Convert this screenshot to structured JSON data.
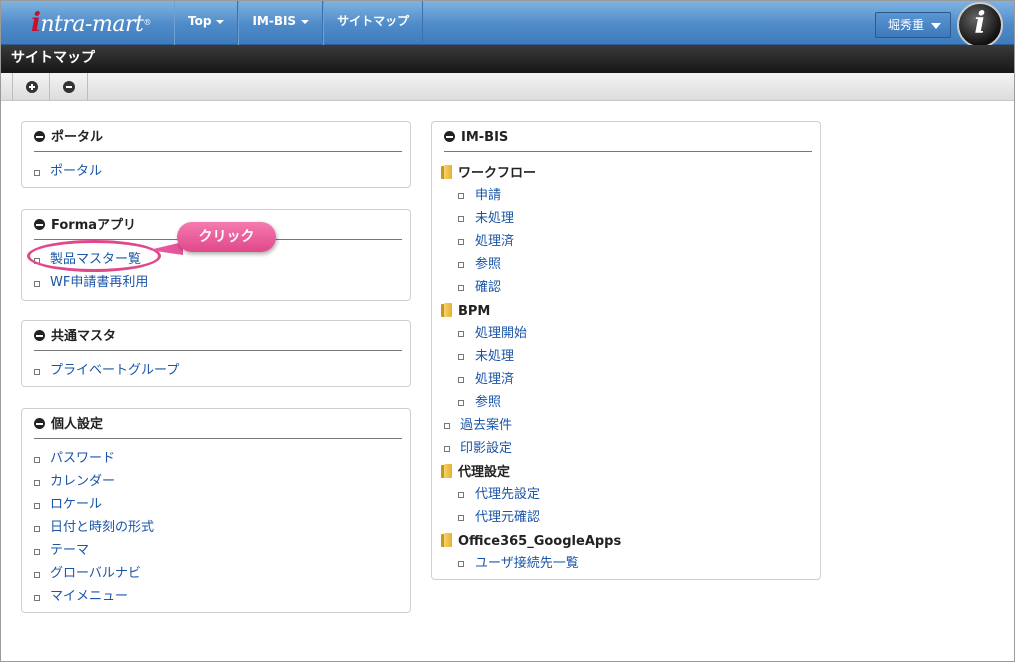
{
  "header": {
    "logo_text": "intra-mart",
    "nav": [
      {
        "label": "Top",
        "dropdown": true
      },
      {
        "label": "IM-BIS",
        "dropdown": true
      },
      {
        "label": "サイトマップ",
        "dropdown": false
      }
    ],
    "user_label": "堀秀重",
    "info_glyph": "i"
  },
  "page_title": "サイトマップ",
  "toolbar": {
    "expand_icon": "plus-circle-icon",
    "collapse_icon": "minus-circle-icon"
  },
  "panels": {
    "portal": {
      "title": "ポータル",
      "links": [
        "ポータル"
      ]
    },
    "forma": {
      "title": "Formaアプリ",
      "links": [
        "製品マスター覧",
        "WF申請書再利用"
      ]
    },
    "common_master": {
      "title": "共通マスタ",
      "links": [
        "プライベートグループ"
      ]
    },
    "personal": {
      "title": "個人設定",
      "links": [
        "パスワード",
        "カレンダー",
        "ロケール",
        "日付と時刻の形式",
        "テーマ",
        "グローバルナビ",
        "マイメニュー"
      ]
    },
    "imbis": {
      "title": "IM-BIS",
      "groups": {
        "workflow": {
          "label": "ワークフロー",
          "links": [
            "申請",
            "未処理",
            "処理済",
            "参照",
            "確認"
          ]
        },
        "bpm": {
          "label": "BPM",
          "links": [
            "処理開始",
            "未処理",
            "処理済",
            "参照"
          ]
        },
        "root_links": [
          "過去案件",
          "印影設定"
        ],
        "proxy": {
          "label": "代理設定",
          "links": [
            "代理先設定",
            "代理元確認"
          ]
        },
        "office": {
          "label": "Office365_GoogleApps",
          "links": [
            "ユーザ接続先一覧"
          ]
        }
      }
    }
  },
  "annotation": {
    "callout": "クリック"
  },
  "colors": {
    "link": "#1a55a8",
    "header_blue": "#4f8bc9",
    "callout_pink": "#e0478a"
  }
}
